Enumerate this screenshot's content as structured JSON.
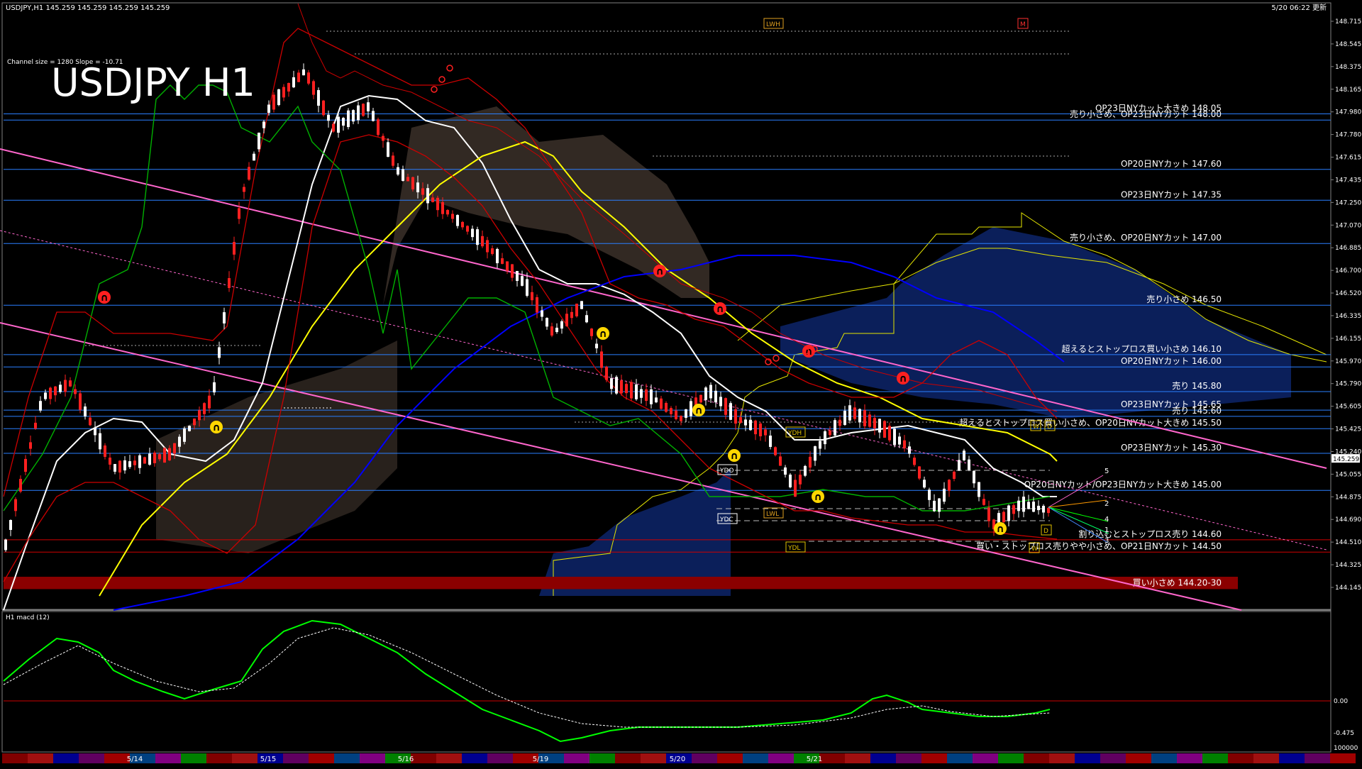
{
  "header": {
    "ohlc": "USDJPY,H1  145.259 145.259 145.259 145.259",
    "datetime": "5/20 06:22 更新"
  },
  "info": {
    "channel_text": "Channel size = 1280 Slope = -10.71",
    "big_title": "USDJPY H1"
  },
  "macd_panel": {
    "title": "H1  macd (12)",
    "zero_label": "0.00",
    "low_label": "-0.475",
    "bottom_label": "100000"
  },
  "colors": {
    "hline": "#2a7fff",
    "channel": "#ff66cc",
    "white_ma": "#ffffff",
    "yellow_ma": "#ffff00",
    "blue_ma": "#0000ff",
    "green_line": "#00b000",
    "red_band": "#cc0000",
    "buy_zone": "#8b0000",
    "macd_up": "#00ff00",
    "macd_down": "#ff88aa"
  },
  "chart_data": {
    "type": "candlestick",
    "title": "USDJPY H1",
    "current_price": "145.259",
    "ylim": [
      144.145,
      148.8
    ],
    "y_ticks": [
      "148.715",
      "148.545",
      "148.375",
      "148.165",
      "147.980",
      "147.780",
      "147.615",
      "147.435",
      "147.250",
      "147.070",
      "146.885",
      "146.700",
      "146.520",
      "146.335",
      "146.155",
      "145.970",
      "145.790",
      "145.605",
      "145.425",
      "145.240",
      "145.055",
      "144.875",
      "144.690",
      "144.510",
      "144.325",
      "144.145"
    ],
    "x_labels": [
      "5/14",
      "5/15",
      "5/16",
      "5/19",
      "5/20",
      "5/21"
    ],
    "levels": [
      {
        "label": "OP23日NYカット大きめ 148.05",
        "price": 148.05
      },
      {
        "label": "売り小さめ、OP23日NYカット 148.00",
        "price": 148.0
      },
      {
        "label": "OP20日NYカット 147.60",
        "price": 147.6
      },
      {
        "label": "OP23日NYカット 147.35",
        "price": 147.35
      },
      {
        "label": "売り小さめ、OP20日NYカット 147.00",
        "price": 147.0
      },
      {
        "label": "売り小さめ 146.50",
        "price": 146.5
      },
      {
        "label": "超えるとストップロス買い小さめ 146.10",
        "price": 146.1
      },
      {
        "label": "OP20日NYカット 146.00",
        "price": 146.0
      },
      {
        "label": "売り 145.80",
        "price": 145.8
      },
      {
        "label": "OP23日NYカット 145.65",
        "price": 145.65
      },
      {
        "label": "売り 145.60",
        "price": 145.6
      },
      {
        "label": "超えるとストップロス買い小さめ、OP20日NYカット大きめ 145.50",
        "price": 145.5
      },
      {
        "label": "OP23日NYカット 145.30",
        "price": 145.3
      },
      {
        "label": "OP20日NYカット/OP23日NYカット大きめ 145.00",
        "price": 145.0
      },
      {
        "label": "割り込むとストップロス売り 144.60",
        "price": 144.6
      },
      {
        "label": "買い・ストップロス売りやや小さめ、OP21日NYカット 144.50",
        "price": 144.5
      }
    ],
    "buy_zone": {
      "label": "買い小さめ 144.20-30",
      "low": 144.2,
      "high": 144.3
    },
    "markers": [
      "LWH",
      "M",
      "W",
      "D",
      "YDH",
      "YDO",
      "YDC",
      "LWL",
      "YDL",
      "D",
      "W"
    ],
    "projection_labels": [
      "5",
      "2",
      "4",
      "1",
      "3"
    ]
  }
}
